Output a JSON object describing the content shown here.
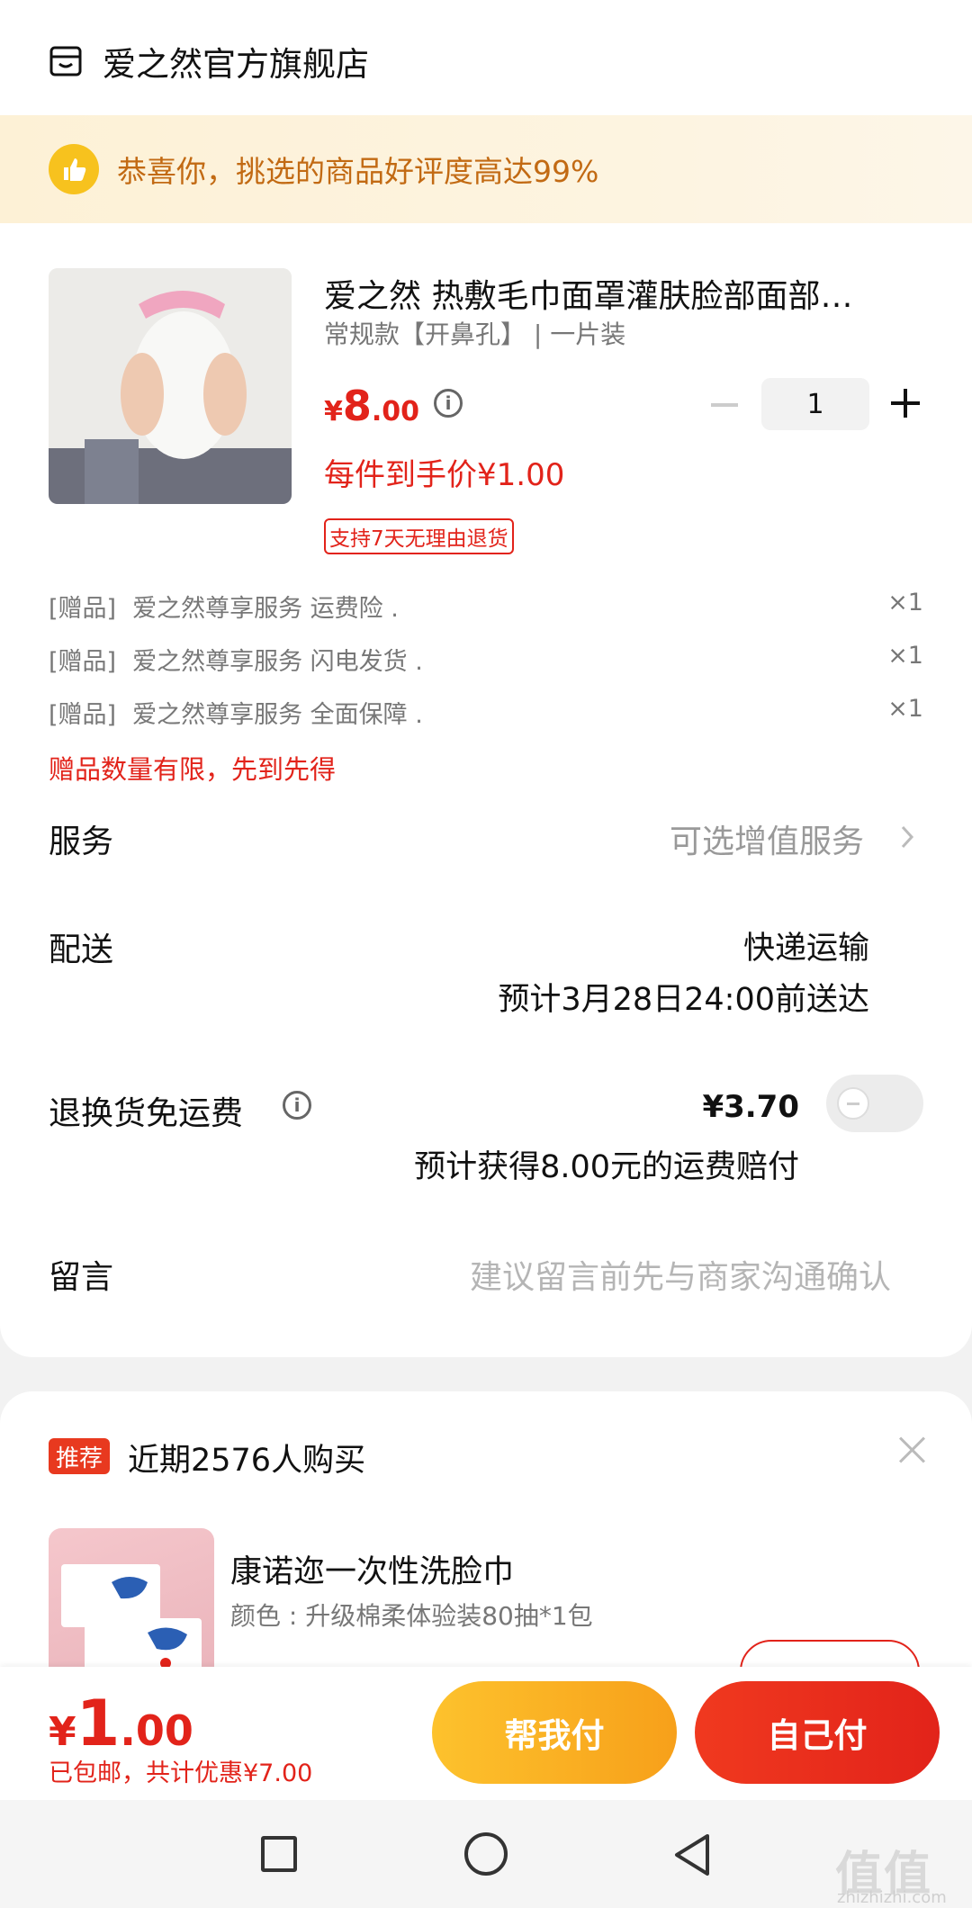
{
  "store": {
    "name": "爱之然官方旗舰店",
    "icon": "store-icon"
  },
  "banner": {
    "icon": "thumbs-up-icon",
    "text": "恭喜你，挑选的商品好评度高达99%"
  },
  "product": {
    "title": "爱之然  热敷毛巾面罩灌肤脸部面部…",
    "spec": "常规款【开鼻孔】 | 一片装",
    "price_currency": "¥",
    "price_int": "8",
    "price_dec": ".00",
    "unit_price": "每件到手价¥1.00",
    "return_badge": "支持7天无理由退货",
    "quantity": "1"
  },
  "gifts": [
    {
      "tag": "[赠品]",
      "name": "爱之然尊享服务 运费险 .",
      "qty": "×1"
    },
    {
      "tag": "[赠品]",
      "name": "爱之然尊享服务 闪电发货 .",
      "qty": "×1"
    },
    {
      "tag": "[赠品]",
      "name": "爱之然尊享服务 全面保障 .",
      "qty": "×1"
    }
  ],
  "gift_note": "赠品数量有限，先到先得",
  "service": {
    "label": "服务",
    "value": "可选增值服务"
  },
  "delivery": {
    "label": "配送",
    "method": "快递运输",
    "eta": "预计3月28日24:00前送达"
  },
  "return_fee": {
    "label": "退换货免运费",
    "price": "¥3.70",
    "note": "预计获得8.00元的运费赔付",
    "enabled": false
  },
  "message": {
    "label": "留言",
    "placeholder": "建议留言前先与商家沟通确认"
  },
  "recommend": {
    "tag": "推荐",
    "title": "近期2576人购买",
    "item_name": "康诺迩一次性洗脸巾",
    "item_spec": "颜色 : 升级棉柔体验装80抽*1包"
  },
  "paybar": {
    "currency": "¥",
    "total_int": "1",
    "total_dec": ".00",
    "note": "已包邮，共计优惠¥7.00",
    "help_label": "帮我付",
    "self_label": "自己付"
  },
  "watermark": {
    "text": "值值值",
    "sub": "zhizhizhi.com"
  },
  "colors": {
    "accent": "#e2231a",
    "banner_text": "#c26a13",
    "help_button": "#fdc22d"
  }
}
